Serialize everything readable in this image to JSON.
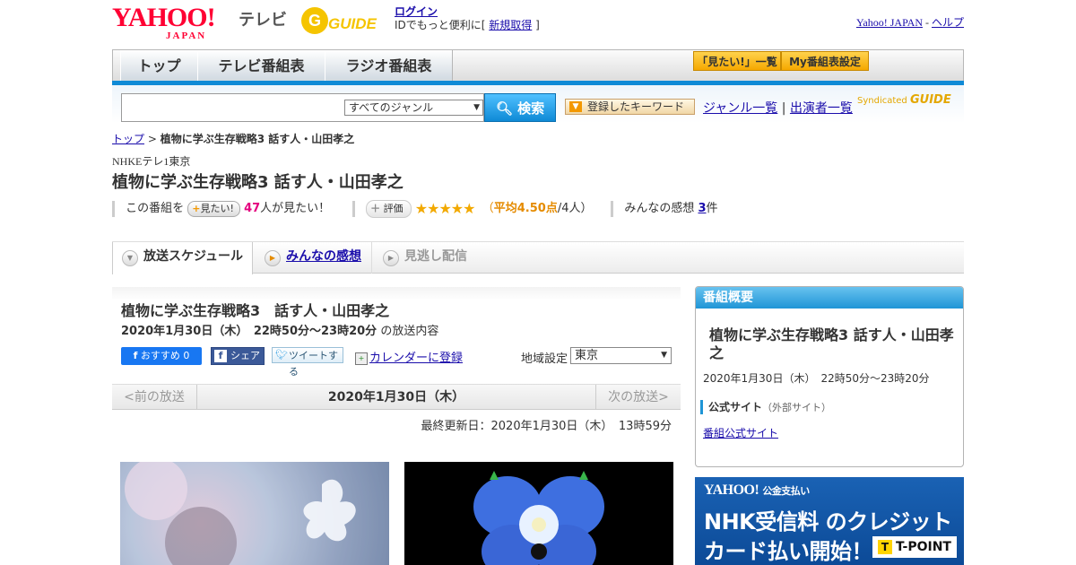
{
  "header": {
    "logo_yahoo": "YAHOO!",
    "logo_japan": "JAPAN",
    "logo_tv": "テレビ",
    "logo_gguide": "GUIDE",
    "login_label": "ログイン",
    "login_prefix": "IDでもっと便利に[",
    "register_label": "新規取得",
    "login_suffix": "]",
    "top_links": [
      "Yahoo! JAPAN",
      "ヘルプ"
    ]
  },
  "nav": {
    "tabs": [
      "トップ",
      "テレビ番組表",
      "ラジオ番組表"
    ],
    "mitai_list": "「見たい!」一覧",
    "my_schedule": "My番組表設定"
  },
  "search": {
    "genre_selected": "すべてのジャンル",
    "button_label": "検索",
    "keyword_button": "登録したキーワード",
    "genre_list": "ジャンル一覧",
    "performer_list": "出演者一覧",
    "syndicated": "Syndicated"
  },
  "breadcrumb": {
    "home": "トップ",
    "separator": ">",
    "current": "植物に学ぶ生存戦略3 話す人・山田孝之"
  },
  "program": {
    "channel": "NHKEテレ1東京",
    "title": "植物に学ぶ生存戦略3 話す人・山田孝之",
    "this_program": "この番組を",
    "mitai_button": "見たい!",
    "mitai_count": "47",
    "mitai_suffix": "人が見たい！",
    "eval_button": "評価",
    "stars": "★★★★★",
    "avg_prefix": "（",
    "avg_label": "平均4.50点",
    "avg_suffix": "/4人）",
    "impressions_label": "みんなの感想",
    "impressions_count": "3",
    "impressions_unit": "件",
    "rating": 4.5
  },
  "tabs": [
    "放送スケジュール",
    "みんなの感想",
    "見逃し配信"
  ],
  "schedule": {
    "title": "植物に学ぶ生存戦略3　話す人・山田孝之",
    "datetime": "2020年1月30日（木）　22時50分～23時20分",
    "datetime_suffix": "の放送内容",
    "fb_recommend": "おすすめ 0",
    "share": "シェア",
    "tweet": "ツイートする",
    "calendar": "カレンダーに登録",
    "region_label": "地域設定",
    "region_value": "東京",
    "prev": "<前の放送",
    "current_date": "2020年1月30日（木）",
    "next": "次の放送>",
    "updated": "最終更新日：2020年1月30日（木）　13時59分"
  },
  "sidebar": {
    "header": "番組概要",
    "title": "植物に学ぶ生存戦略3 話す人・山田孝之",
    "time": "2020年1月30日（木）　22時50分～23時20分",
    "official_label": "公式サイト",
    "official_note": "（外部サイト）",
    "official_link": "番組公式サイト"
  },
  "ad": {
    "brand": "YAHOO!",
    "brand_sub": "公金支払い",
    "line1": "NHK受信料 のクレジット",
    "line2": "カード払い開始！",
    "tpoint": "T-POINT"
  },
  "colors": {
    "accent_blue": "#0f8ad6",
    "yahoo_red": "#ff0033",
    "star": "#f2a900",
    "pink_count": "#e4007f"
  }
}
